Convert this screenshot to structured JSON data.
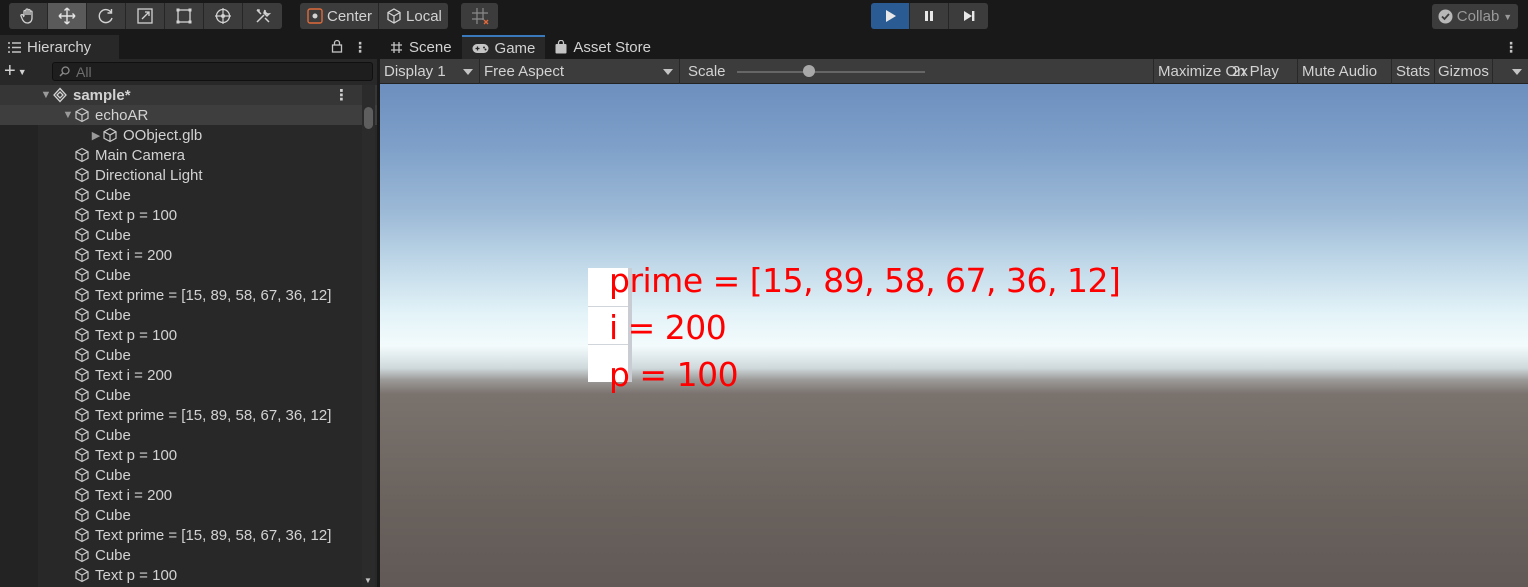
{
  "toolbar": {
    "tools": [
      {
        "icon": "hand-tool-icon"
      },
      {
        "icon": "move-tool-icon",
        "active": true
      },
      {
        "icon": "rotate-tool-icon"
      },
      {
        "icon": "scale-tool-icon"
      },
      {
        "icon": "rect-tool-icon"
      },
      {
        "icon": "transform-tool-icon"
      },
      {
        "icon": "custom-tool-icon"
      }
    ],
    "pivot_mode": "Center",
    "pivot_rotation": "Local",
    "snap_icon": "grid-snap-icon",
    "play_icon": "play-icon",
    "pause_icon": "pause-icon",
    "step_icon": "step-icon",
    "collab_label": "Collab"
  },
  "hierarchy": {
    "tab_label": "Hierarchy",
    "search_placeholder": "All",
    "scene_name": "sample*",
    "items": [
      {
        "label": "echoAR",
        "depth": 1,
        "expand": "open",
        "selected": true
      },
      {
        "label": "OObject.glb",
        "depth": 2,
        "expand": "closed"
      },
      {
        "label": "Main Camera",
        "depth": 1
      },
      {
        "label": "Directional Light",
        "depth": 1
      },
      {
        "label": "Cube",
        "depth": 1
      },
      {
        "label": "Text p = 100",
        "depth": 1
      },
      {
        "label": "Cube",
        "depth": 1
      },
      {
        "label": "Text i = 200",
        "depth": 1
      },
      {
        "label": "Cube",
        "depth": 1
      },
      {
        "label": "Text prime = [15, 89, 58, 67, 36, 12]",
        "depth": 1
      },
      {
        "label": "Cube",
        "depth": 1
      },
      {
        "label": "Text p = 100",
        "depth": 1
      },
      {
        "label": "Cube",
        "depth": 1
      },
      {
        "label": "Text i = 200",
        "depth": 1
      },
      {
        "label": "Cube",
        "depth": 1
      },
      {
        "label": "Text prime = [15, 89, 58, 67, 36, 12]",
        "depth": 1
      },
      {
        "label": "Cube",
        "depth": 1
      },
      {
        "label": "Text p = 100",
        "depth": 1
      },
      {
        "label": "Cube",
        "depth": 1
      },
      {
        "label": "Text i = 200",
        "depth": 1
      },
      {
        "label": "Cube",
        "depth": 1
      },
      {
        "label": "Text prime = [15, 89, 58, 67, 36, 12]",
        "depth": 1
      },
      {
        "label": "Cube",
        "depth": 1
      },
      {
        "label": "Text p = 100",
        "depth": 1
      }
    ]
  },
  "game_panel": {
    "tabs": [
      {
        "label": "Scene",
        "icon": "scene-grid-icon",
        "active": false
      },
      {
        "label": "Game",
        "icon": "gamepad-icon",
        "active": true
      },
      {
        "label": "Asset Store",
        "icon": "store-bag-icon",
        "active": false
      }
    ],
    "display": "Display 1",
    "aspect": "Free Aspect",
    "scale_label": "Scale",
    "scale_value": "2x",
    "maximize_label": "Maximize On Play",
    "mute_label": "Mute Audio",
    "stats_label": "Stats",
    "gizmos_label": "Gizmos"
  },
  "viewport": {
    "lines": [
      "prime = [15, 89, 58, 67, 36, 12]",
      "i = 200",
      "p = 100"
    ],
    "text_color": "#ff0000"
  }
}
